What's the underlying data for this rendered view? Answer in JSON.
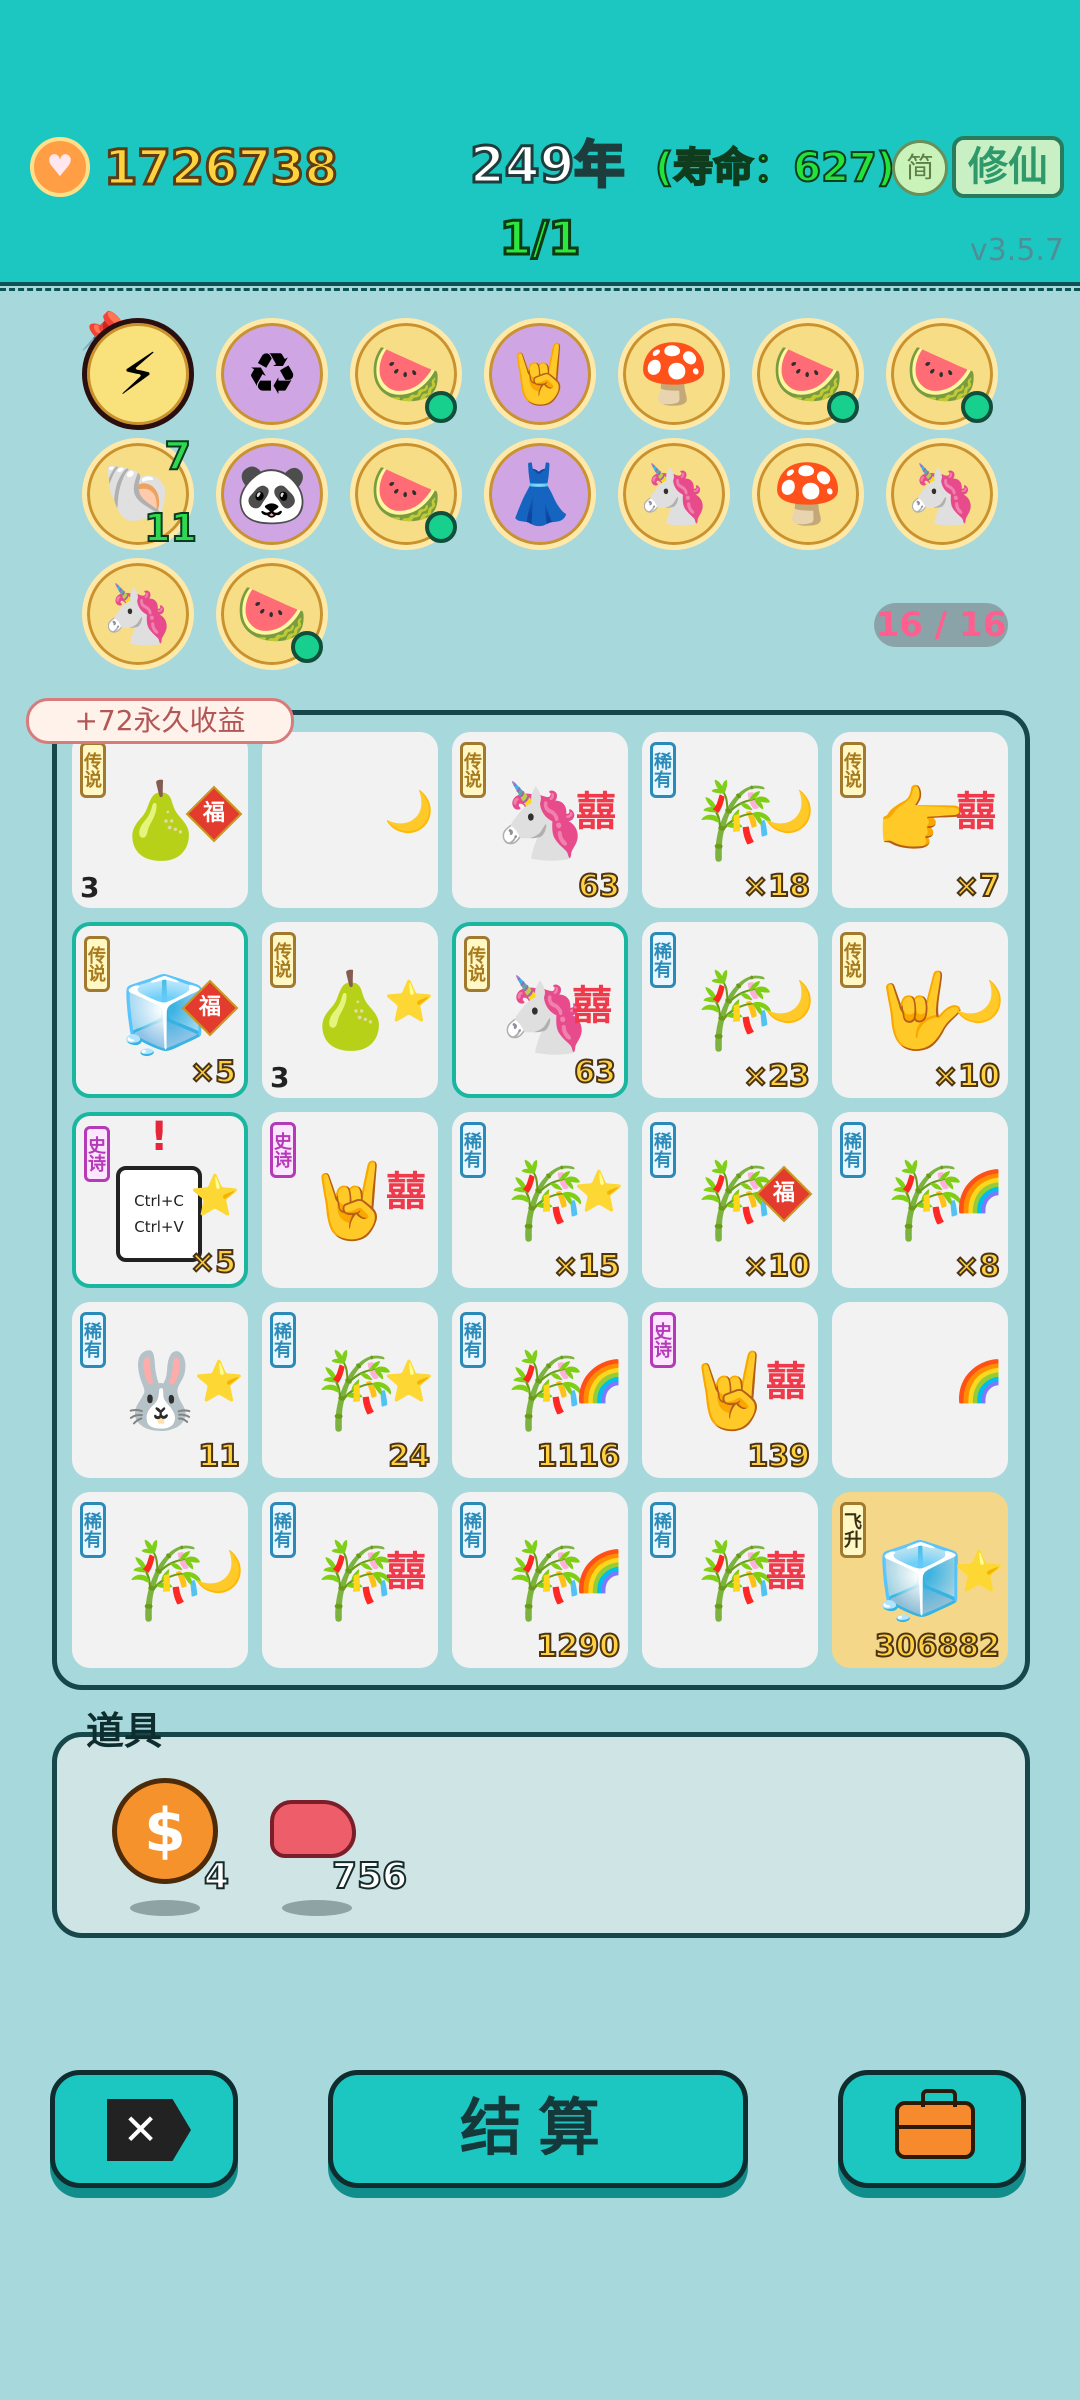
{
  "header": {
    "coins": "1726738",
    "year": "249年",
    "lifespan": "(寿命：627)",
    "simplified_label": "简",
    "cultivate_label": "修仙",
    "round": "1/1",
    "version": "v3.5.7"
  },
  "tokens": {
    "slots": "16 / 16",
    "items": [
      {
        "icon": "lightning-icon",
        "glyph": "⚡"
      },
      {
        "icon": "recycle-icon",
        "glyph": "♻"
      },
      {
        "icon": "fruit-basket-icon",
        "glyph": "🍉"
      },
      {
        "icon": "rock-hand-icon",
        "glyph": "🤘"
      },
      {
        "icon": "mushroom-cloud-icon",
        "glyph": "🍄"
      },
      {
        "icon": "fruit-basket-icon",
        "glyph": "🍉"
      },
      {
        "icon": "fruit-basket-icon",
        "glyph": "🍉"
      },
      {
        "icon": "shell-icon",
        "glyph": "🐚",
        "count_top": "7",
        "count_bottom": "11"
      },
      {
        "icon": "panda-icon",
        "glyph": "🐼"
      },
      {
        "icon": "fruit-basket-icon",
        "glyph": "🍉"
      },
      {
        "icon": "skirt-icon",
        "glyph": "👗"
      },
      {
        "icon": "unicorn-icon",
        "glyph": "🦄"
      },
      {
        "icon": "mushroom-cloud-icon",
        "glyph": "🍄"
      },
      {
        "icon": "unicorn-icon",
        "glyph": "🦄"
      },
      {
        "icon": "unicorn-icon",
        "glyph": "🦄"
      },
      {
        "icon": "fruit-basket-icon",
        "glyph": "🍉"
      }
    ]
  },
  "board": {
    "permanent_income": "+72永久收益",
    "cells": [
      {
        "tag": "传说",
        "tag_type": "legend",
        "main": "🍐",
        "main_name": "gourd-icon",
        "side": "福",
        "side_type": "fu",
        "left": "3"
      },
      {
        "tag": "",
        "main": "",
        "side": "🌙",
        "side_type": "moon"
      },
      {
        "tag": "传说",
        "tag_type": "legend",
        "main": "🦄",
        "main_name": "unicorn-icon",
        "side": "囍",
        "side_type": "xi",
        "num": "63"
      },
      {
        "tag": "稀有",
        "tag_type": "rare",
        "main": "🎋",
        "main_name": "bamboo-icon",
        "side": "🌙",
        "side_type": "moon",
        "num": "×18"
      },
      {
        "tag": "传说",
        "tag_type": "legend",
        "main": "👉",
        "main_name": "pointing-hand-icon",
        "side": "囍",
        "side_type": "xi",
        "num": "×7"
      },
      {
        "tag": "传说",
        "tag_type": "legend",
        "main": "🧊",
        "main_name": "fridge-icon",
        "side": "福",
        "side_type": "fu",
        "num": "×5",
        "hl": true
      },
      {
        "tag": "传说",
        "tag_type": "legend",
        "main": "🍐",
        "main_name": "gourd-icon",
        "side": "⭐",
        "side_type": "star",
        "left": "3"
      },
      {
        "tag": "传说",
        "tag_type": "legend",
        "main": "🦄",
        "main_name": "crowned-unicorn-icon",
        "side": "囍",
        "side_type": "xi",
        "num": "63",
        "hl": true
      },
      {
        "tag": "稀有",
        "tag_type": "rare",
        "main": "🎋",
        "main_name": "bamboo-icon",
        "side": "🌙",
        "side_type": "moon",
        "num": "×23"
      },
      {
        "tag": "传说",
        "tag_type": "legend",
        "main": "🤟",
        "main_name": "yellow-hand-icon",
        "side": "🌙",
        "side_type": "moon",
        "num": "×10"
      },
      {
        "tag": "史诗",
        "tag_type": "epic",
        "main": "ctrl",
        "main_name": "copy-paste-card",
        "ctrl1": "Ctrl+C",
        "ctrl2": "Ctrl+V",
        "side": "⭐",
        "side_type": "star",
        "num": "×5",
        "hl": true,
        "alert": "!"
      },
      {
        "tag": "史诗",
        "tag_type": "epic",
        "main": "🤘",
        "main_name": "gray-hand-icon",
        "side": "囍",
        "side_type": "xi"
      },
      {
        "tag": "稀有",
        "tag_type": "rare",
        "main": "🎋",
        "main_name": "bamboo-icon",
        "side": "⭐",
        "side_type": "star",
        "num": "×15"
      },
      {
        "tag": "稀有",
        "tag_type": "rare",
        "main": "🎋",
        "main_name": "bamboo-icon",
        "side": "福",
        "side_type": "fu",
        "num": "×10"
      },
      {
        "tag": "稀有",
        "tag_type": "rare",
        "main": "🎋",
        "main_name": "bamboo-icon",
        "side": "🌈",
        "side_type": "rainbow",
        "num": "×8"
      },
      {
        "tag": "稀有",
        "tag_type": "rare",
        "main": "🐰",
        "main_name": "rabbit-icon",
        "side": "⭐",
        "side_type": "star",
        "num": "11"
      },
      {
        "tag": "稀有",
        "tag_type": "rare",
        "main": "🎋",
        "main_name": "bamboo-icon",
        "side": "⭐",
        "side_type": "star",
        "num": "24"
      },
      {
        "tag": "稀有",
        "tag_type": "rare",
        "main": "🎋",
        "main_name": "bamboo-icon",
        "side": "🌈",
        "side_type": "rainbow",
        "num": "1116"
      },
      {
        "tag": "史诗",
        "tag_type": "epic",
        "main": "🤘",
        "main_name": "gray-hand-icon",
        "side": "囍",
        "side_type": "xi",
        "num": "139"
      },
      {
        "tag": "",
        "main": "",
        "side": "🌈",
        "side_type": "rainbow"
      },
      {
        "tag": "稀有",
        "tag_type": "rare",
        "main": "🎋",
        "main_name": "bamboo-icon",
        "side": "🌙",
        "side_type": "moon"
      },
      {
        "tag": "稀有",
        "tag_type": "rare",
        "main": "🎋",
        "main_name": "bamboo-icon",
        "side": "囍",
        "side_type": "xi"
      },
      {
        "tag": "稀有",
        "tag_type": "rare",
        "main": "🎋",
        "main_name": "bamboo-icon",
        "side": "🌈",
        "side_type": "rainbow",
        "num": "1290"
      },
      {
        "tag": "稀有",
        "tag_type": "rare",
        "main": "🎋",
        "main_name": "bamboo-icon",
        "side": "囍",
        "side_type": "xi"
      },
      {
        "tag": "飞升",
        "tag_type": "fly",
        "main": "🧊",
        "main_name": "ascended-fridge-icon",
        "side": "⭐",
        "side_type": "star",
        "num": "306882",
        "gold": true
      }
    ]
  },
  "props": {
    "label": "道具",
    "coin_count": "4",
    "liver_count": "756"
  },
  "buttons": {
    "settle_label": "结算"
  }
}
